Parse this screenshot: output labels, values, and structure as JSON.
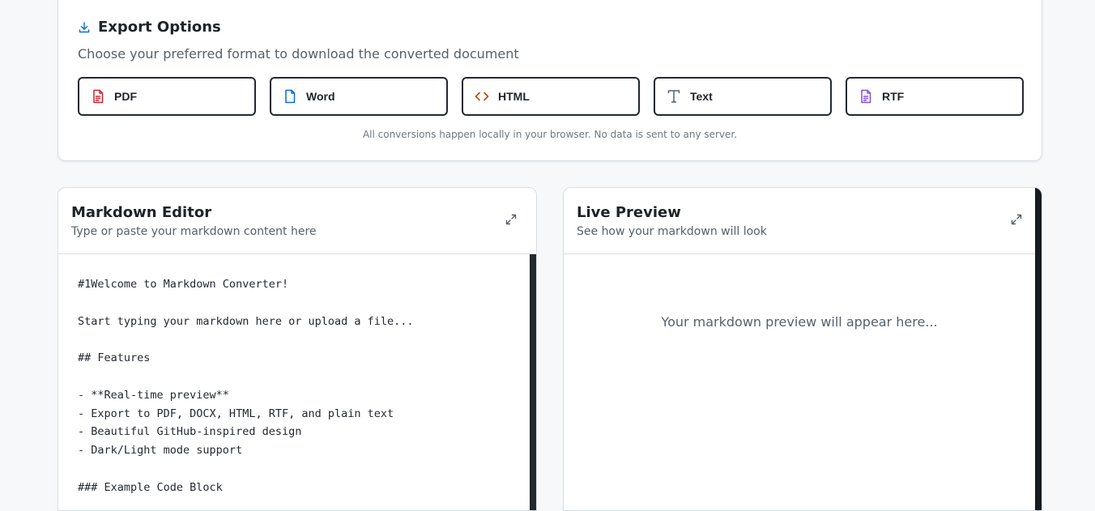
{
  "export": {
    "title": "Export Options",
    "subtitle": "Choose your preferred format to download the converted document",
    "formats": [
      {
        "label": "PDF",
        "icon": "file-text-icon",
        "color": "#cf222e"
      },
      {
        "label": "Word",
        "icon": "file-icon",
        "color": "#0969da"
      },
      {
        "label": "HTML",
        "icon": "code-icon",
        "color": "#bc4c00"
      },
      {
        "label": "Text",
        "icon": "type-icon",
        "color": "#57606a"
      },
      {
        "label": "RTF",
        "icon": "file-text-icon",
        "color": "#8250df"
      }
    ],
    "note": "All conversions happen locally in your browser. No data is sent to any server."
  },
  "editor": {
    "title": "Markdown Editor",
    "subtitle": "Type or paste your markdown content here",
    "content": "#1Welcome to Markdown Converter!\n\nStart typing your markdown here or upload a file...\n\n## Features\n\n- **Real-time preview**\n- Export to PDF, DOCX, HTML, RTF, and plain text\n- Beautiful GitHub-inspired design\n- Dark/Light mode support\n\n### Example Code Block"
  },
  "preview": {
    "title": "Live Preview",
    "subtitle": "See how your markdown will look",
    "placeholder": "Your markdown preview will appear here..."
  }
}
